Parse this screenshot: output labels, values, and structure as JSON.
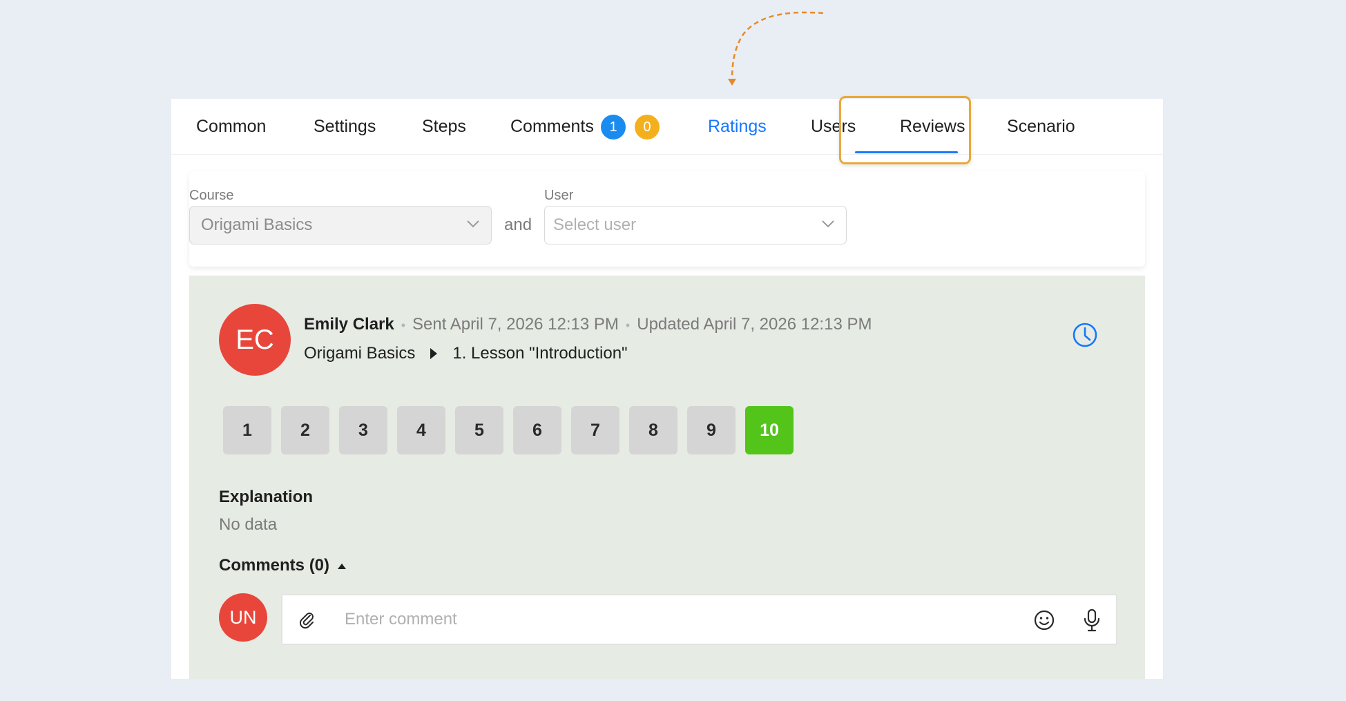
{
  "tabs": [
    {
      "label": "Common"
    },
    {
      "label": "Settings"
    },
    {
      "label": "Steps"
    },
    {
      "label": "Comments",
      "badges": [
        "1",
        "0"
      ]
    },
    {
      "label": "Ratings",
      "active": true
    },
    {
      "label": "Users"
    },
    {
      "label": "Reviews"
    },
    {
      "label": "Scenario"
    }
  ],
  "filters": {
    "course_label": "Course",
    "course_value": "Origami Basics",
    "connector": "and",
    "user_label": "User",
    "user_placeholder": "Select user"
  },
  "rating": {
    "avatar_initials": "EC",
    "author": "Emily Clark",
    "sent": "Sent April 7, 2026 12:13 PM",
    "updated": "Updated April 7, 2026 12:13 PM",
    "course": "Origami Basics",
    "lesson": "1. Lesson \"Introduction\"",
    "scores": [
      "1",
      "2",
      "3",
      "4",
      "5",
      "6",
      "7",
      "8",
      "9",
      "10"
    ],
    "selected_score": 10,
    "explanation_title": "Explanation",
    "explanation_value": "No data",
    "comments_title": "Comments (0)"
  },
  "comment_box": {
    "avatar_initials": "UN",
    "placeholder": "Enter comment"
  },
  "colors": {
    "accent": "#1677ff",
    "selected_score": "#52c41a",
    "avatar": "#e8463b",
    "highlight": "#e9a83a",
    "badge_blue": "#1a8cf0",
    "badge_orange": "#f4b01c"
  },
  "icons": [
    "chevron-down-icon",
    "history-clock-icon",
    "paperclip-icon",
    "emoji-icon",
    "microphone-icon"
  ]
}
